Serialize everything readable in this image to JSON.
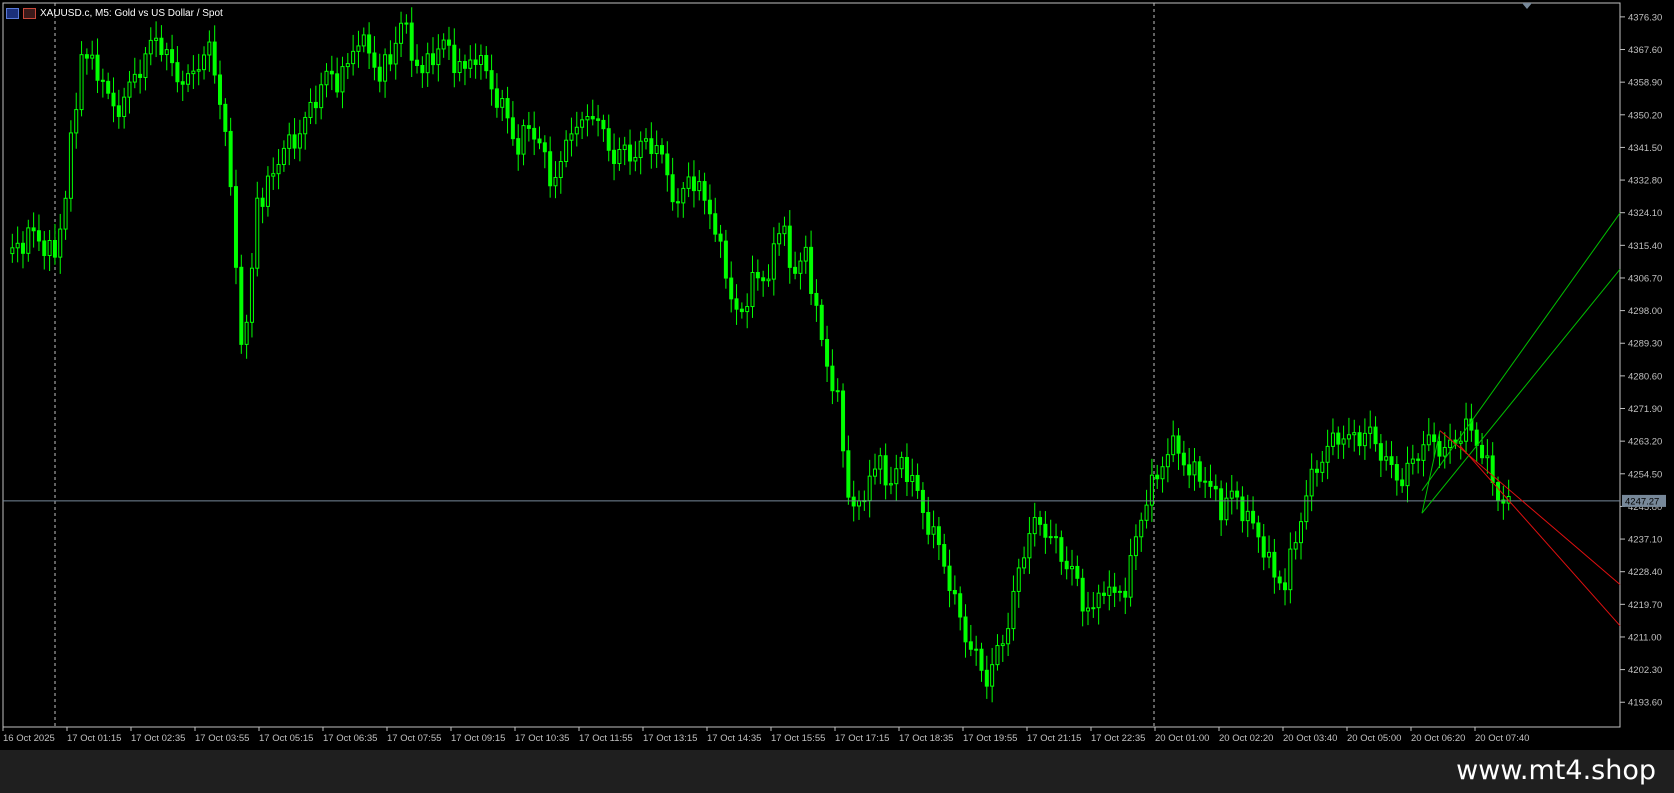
{
  "header": {
    "symbol_label": "XAUUSD.c, M5:  Gold vs US Dollar / Spot"
  },
  "watermark": "www.mt4.shop",
  "colors": {
    "background": "#000000",
    "candle": "#00ff00",
    "grid_axis": "#c0c0c0",
    "bid_line": "#778899",
    "channel_up": "#00c000",
    "channel_down": "#e01010",
    "footer": "#1f1f1f"
  },
  "chart_data": {
    "type": "candlestick",
    "symbol": "XAUUSD.c",
    "timeframe": "M5",
    "ylim": [
      4187.0,
      4380.0
    ],
    "y_ticks": [
      "4376.30",
      "4367.60",
      "4358.90",
      "4350.20",
      "4341.50",
      "4332.80",
      "4324.10",
      "4315.40",
      "4306.70",
      "4298.00",
      "4289.30",
      "4280.60",
      "4271.90",
      "4263.20",
      "4254.50",
      "4245.80",
      "4237.10",
      "4228.40",
      "4219.70",
      "4211.00",
      "4202.30",
      "4193.60"
    ],
    "x_ticks": [
      "16 Oct 2025",
      "17 Oct 01:15",
      "17 Oct 02:35",
      "17 Oct 03:55",
      "17 Oct 05:15",
      "17 Oct 06:35",
      "17 Oct 07:55",
      "17 Oct 09:15",
      "17 Oct 10:35",
      "17 Oct 11:55",
      "17 Oct 13:15",
      "17 Oct 14:35",
      "17 Oct 15:55",
      "17 Oct 17:15",
      "17 Oct 18:35",
      "17 Oct 19:55",
      "17 Oct 21:15",
      "17 Oct 22:35",
      "20 Oct 01:00",
      "20 Oct 02:20",
      "20 Oct 03:40",
      "20 Oct 05:00",
      "20 Oct 06:20",
      "20 Oct 07:40"
    ],
    "current_price": "4247.27",
    "current_price_value": 4247.27,
    "price_path": [
      [
        0,
        4312
      ],
      [
        3,
        4315
      ],
      [
        5,
        4318
      ],
      [
        7,
        4316
      ],
      [
        9,
        4314
      ],
      [
        11,
        4330
      ],
      [
        12,
        4342
      ],
      [
        13,
        4352
      ],
      [
        14,
        4366
      ],
      [
        16,
        4362
      ],
      [
        18,
        4360
      ],
      [
        20,
        4352
      ],
      [
        22,
        4356
      ],
      [
        24,
        4360
      ],
      [
        26,
        4364
      ],
      [
        28,
        4370
      ],
      [
        30,
        4366
      ],
      [
        32,
        4362
      ],
      [
        34,
        4360
      ],
      [
        36,
        4364
      ],
      [
        38,
        4366
      ],
      [
        40,
        4354
      ],
      [
        41,
        4344
      ],
      [
        42,
        4330
      ],
      [
        43,
        4312
      ],
      [
        44,
        4292
      ],
      [
        45,
        4294
      ],
      [
        46,
        4310
      ],
      [
        47,
        4330
      ],
      [
        48,
        4326
      ],
      [
        50,
        4334
      ],
      [
        52,
        4340
      ],
      [
        54,
        4344
      ],
      [
        56,
        4350
      ],
      [
        58,
        4356
      ],
      [
        60,
        4360
      ],
      [
        62,
        4358
      ],
      [
        64,
        4362
      ],
      [
        66,
        4372
      ],
      [
        68,
        4368
      ],
      [
        70,
        4362
      ],
      [
        72,
        4364
      ],
      [
        74,
        4374
      ],
      [
        76,
        4366
      ],
      [
        78,
        4362
      ],
      [
        80,
        4368
      ],
      [
        82,
        4370
      ],
      [
        84,
        4364
      ],
      [
        86,
        4360
      ],
      [
        88,
        4366
      ],
      [
        90,
        4362
      ],
      [
        92,
        4356
      ],
      [
        94,
        4350
      ],
      [
        96,
        4340
      ],
      [
        98,
        4346
      ],
      [
        100,
        4342
      ],
      [
        102,
        4334
      ],
      [
        104,
        4338
      ],
      [
        106,
        4348
      ],
      [
        108,
        4346
      ],
      [
        110,
        4350
      ],
      [
        112,
        4344
      ],
      [
        114,
        4340
      ],
      [
        116,
        4342
      ],
      [
        118,
        4340
      ],
      [
        120,
        4342
      ],
      [
        122,
        4340
      ],
      [
        124,
        4334
      ],
      [
        126,
        4326
      ],
      [
        128,
        4336
      ],
      [
        130,
        4330
      ],
      [
        132,
        4324
      ],
      [
        134,
        4312
      ],
      [
        136,
        4302
      ],
      [
        138,
        4296
      ],
      [
        140,
        4310
      ],
      [
        142,
        4304
      ],
      [
        144,
        4314
      ],
      [
        146,
        4318
      ],
      [
        148,
        4306
      ],
      [
        150,
        4316
      ],
      [
        152,
        4298
      ],
      [
        154,
        4284
      ],
      [
        156,
        4272
      ],
      [
        158,
        4248
      ],
      [
        160,
        4244
      ],
      [
        162,
        4256
      ],
      [
        164,
        4258
      ],
      [
        166,
        4252
      ],
      [
        168,
        4256
      ],
      [
        170,
        4252
      ],
      [
        172,
        4244
      ],
      [
        174,
        4240
      ],
      [
        176,
        4232
      ],
      [
        178,
        4220
      ],
      [
        180,
        4210
      ],
      [
        182,
        4204
      ],
      [
        184,
        4200
      ],
      [
        186,
        4208
      ],
      [
        188,
        4216
      ],
      [
        190,
        4228
      ],
      [
        192,
        4238
      ],
      [
        194,
        4240
      ],
      [
        196,
        4238
      ],
      [
        198,
        4234
      ],
      [
        200,
        4230
      ],
      [
        202,
        4220
      ],
      [
        204,
        4216
      ],
      [
        206,
        4224
      ],
      [
        208,
        4222
      ],
      [
        210,
        4226
      ],
      [
        212,
        4238
      ],
      [
        214,
        4248
      ],
      [
        216,
        4252
      ],
      [
        218,
        4260
      ],
      [
        220,
        4262
      ],
      [
        222,
        4256
      ],
      [
        224,
        4256
      ],
      [
        226,
        4250
      ],
      [
        228,
        4244
      ],
      [
        230,
        4248
      ],
      [
        232,
        4246
      ],
      [
        234,
        4242
      ],
      [
        236,
        4236
      ],
      [
        238,
        4226
      ],
      [
        240,
        4224
      ],
      [
        242,
        4236
      ],
      [
        244,
        4250
      ],
      [
        246,
        4258
      ],
      [
        248,
        4262
      ],
      [
        250,
        4264
      ],
      [
        252,
        4262
      ],
      [
        254,
        4264
      ],
      [
        256,
        4266
      ],
      [
        258,
        4262
      ],
      [
        260,
        4256
      ],
      [
        262,
        4252
      ],
      [
        264,
        4256
      ],
      [
        266,
        4262
      ],
      [
        268,
        4264
      ],
      [
        270,
        4262
      ],
      [
        272,
        4264
      ],
      [
        274,
        4266
      ],
      [
        276,
        4262
      ],
      [
        278,
        4256
      ],
      [
        280,
        4250
      ],
      [
        282,
        4247
      ]
    ],
    "channels": [
      {
        "color": "red",
        "points": [
          [
            4268.0,
            4247.0
          ],
          [
            4264.0,
            4242.0
          ]
        ]
      },
      {
        "color": "green",
        "points": [
          [
            4250.0,
            4263.0
          ],
          [
            4247.0,
            4258.0
          ]
        ]
      }
    ]
  }
}
